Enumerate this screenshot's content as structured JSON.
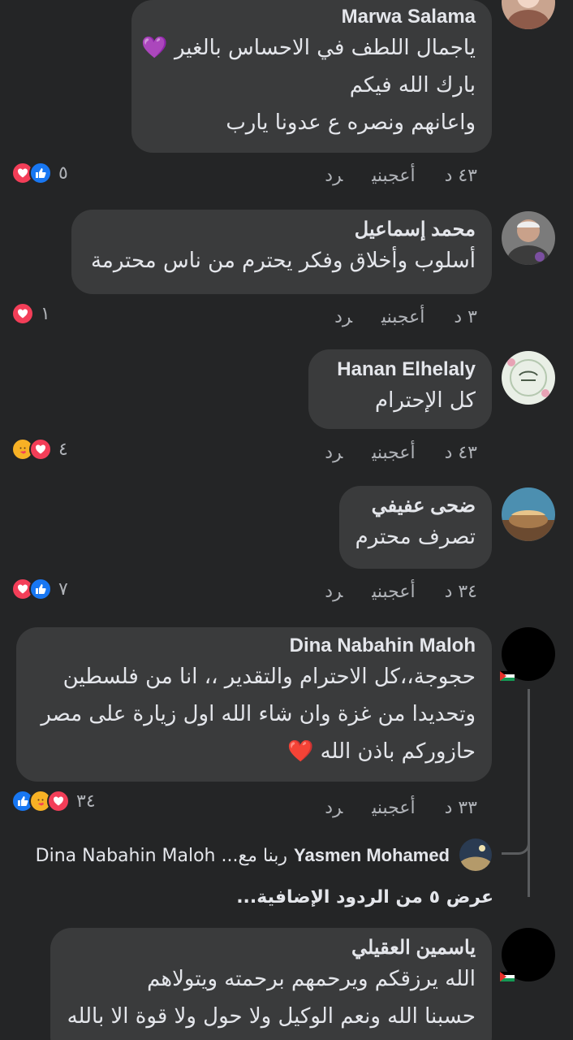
{
  "comments": [
    {
      "author": "Marwa Salama",
      "lines": [
        "ياجمال اللطف في الاحساس بالغير 💜",
        "بارك الله فيكم",
        "واعانهم ونصره ع عدونا يارب"
      ],
      "time": "٤٣ د",
      "like_label": "أعجبني",
      "reply_label": "رد",
      "reaction_count": "٥"
    },
    {
      "author": "محمد إسماعيل",
      "lines": [
        "أسلوب وأخلاق وفكر يحترم من ناس محترمة"
      ],
      "time": "٣ د",
      "like_label": "أعجبني",
      "reply_label": "رد",
      "reaction_count": "١"
    },
    {
      "author": "Hanan Elhelaly",
      "lines": [
        "كل الإحترام"
      ],
      "time": "٤٣ د",
      "like_label": "أعجبني",
      "reply_label": "رد",
      "reaction_count": "٤"
    },
    {
      "author": "ضحى عفيفي",
      "lines": [
        "تصرف محترم"
      ],
      "time": "٣٤ د",
      "like_label": "أعجبني",
      "reply_label": "رد",
      "reaction_count": "٧"
    },
    {
      "author": "Dina Nabahin Maloh",
      "lines": [
        "حجوجة،،كل الاحترام والتقدير ،، انا من فلسطين",
        "وتحديدا من غزة وان شاء الله اول زيارة على مصر",
        "حازوركم باذن الله ❤️"
      ],
      "time": "٣٣ د",
      "like_label": "أعجبني",
      "reply_label": "رد",
      "reaction_count": "٣٤"
    },
    {
      "author": "ياسمين العقيلي",
      "lines": [
        "الله يرزقكم ويرحمهم برحمته ويتولاهم",
        "حسبنا الله ونعم الوكيل ولا حول ولا قوة الا بالله"
      ]
    }
  ],
  "reply_preview": {
    "author": "Yasmen Mohamed",
    "text": "ربنا مع... Dina Nabahin Maloh"
  },
  "more_replies": "عرض ٥ من الردود الإضافية...",
  "colors": {
    "background": "#242526",
    "bubble": "#3a3b3c",
    "like": "#1877f2",
    "love": "#f33e58",
    "care": "#f7b125"
  }
}
